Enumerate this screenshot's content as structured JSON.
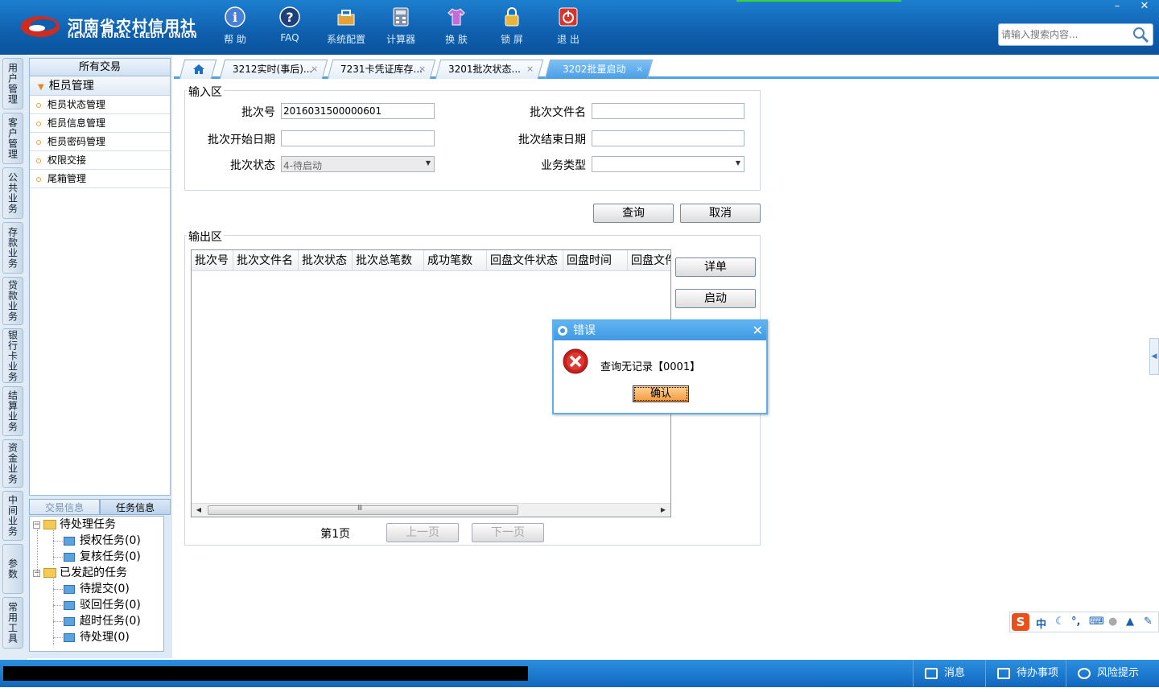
{
  "header": {
    "logo_cn": "河南省农村信用社",
    "logo_en": "HENAN RURAL CREDIT UNION",
    "tools": [
      {
        "label": "帮 助",
        "icon": "info-icon"
      },
      {
        "label": "FAQ",
        "icon": "question-icon"
      },
      {
        "label": "系统配置",
        "icon": "toolbox-icon"
      },
      {
        "label": "计算器",
        "icon": "calculator-icon"
      },
      {
        "label": "换 肤",
        "icon": "shirt-icon"
      },
      {
        "label": "锁 屏",
        "icon": "lock-icon"
      },
      {
        "label": "退 出",
        "icon": "power-icon"
      }
    ],
    "minimize": "–",
    "close": "✕",
    "search_placeholder": "请输入搜索内容..."
  },
  "vtabs": [
    "用户管理",
    "客户管理",
    "公共业务",
    "存款业务",
    "贷款业务",
    "银行卡业务",
    "结算业务",
    "资金业务",
    "中间业务",
    "参数",
    "常用工具"
  ],
  "left_panel": {
    "title": "所有交易",
    "group": "柜员管理",
    "items": [
      "柜员状态管理",
      "柜员信息管理",
      "柜员密码管理",
      "权限交接",
      "尾箱管理"
    ],
    "tabs": [
      "交易信息",
      "任务信息"
    ],
    "tree": {
      "pending": "待处理任务",
      "pending_children": [
        "授权任务(0)",
        "复核任务(0)"
      ],
      "started": "已发起的任务",
      "started_children": [
        "待提交(0)",
        "驳回任务(0)",
        "超时任务(0)",
        "待处理(0)"
      ]
    }
  },
  "content_tabs": [
    {
      "label": "3212实时(事后)...",
      "close": "×"
    },
    {
      "label": "7231卡凭证库存...",
      "close": "×"
    },
    {
      "label": "3201批次状态...",
      "close": "×"
    },
    {
      "label": "3202批量启动",
      "close": "×"
    }
  ],
  "input_area": {
    "legend": "输入区",
    "batch_no_label": "批次号",
    "batch_no_value": "2016031500000601",
    "batch_file_label": "批次文件名",
    "batch_file_value": "",
    "start_date_label": "批次开始日期",
    "start_date_value": "",
    "end_date_label": "批次结束日期",
    "end_date_value": "",
    "status_label": "批次状态",
    "status_value": "4-待启动",
    "biz_type_label": "业务类型",
    "biz_type_value": ""
  },
  "buttons": {
    "query": "查询",
    "cancel": "取消",
    "detail": "详单",
    "start": "启动",
    "prev": "上一页",
    "next": "下一页"
  },
  "output_area": {
    "legend": "输出区",
    "columns": [
      "批次号",
      "批次文件名",
      "批次状态",
      "批次总笔数",
      "成功笔数",
      "回盘文件状态",
      "回盘时间",
      "回盘文件"
    ],
    "scroll_grip": "Ⅲ",
    "page": "第1页"
  },
  "dialog": {
    "title": "错误",
    "close": "✕",
    "message": "查询无记录【0001】",
    "ok": "确认"
  },
  "ime": {
    "logo": "S",
    "mode": "中"
  },
  "statusbar": {
    "messages": "消息",
    "todo": "待办事项",
    "risk": "风险提示"
  }
}
